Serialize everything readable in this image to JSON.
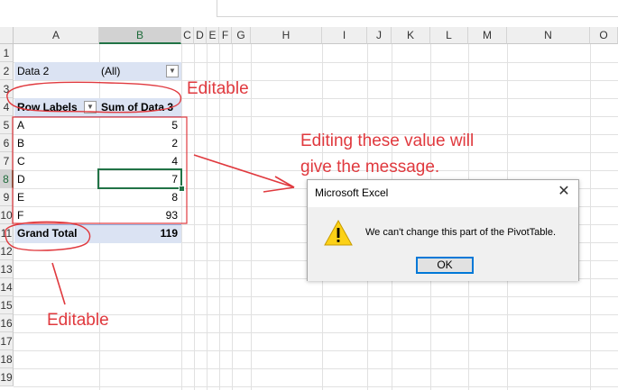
{
  "columns": [
    "A",
    "B",
    "C",
    "D",
    "E",
    "F",
    "G",
    "H",
    "I",
    "J",
    "K",
    "L",
    "M",
    "N",
    "O"
  ],
  "rows": [
    "1",
    "2",
    "3",
    "4",
    "5",
    "6",
    "7",
    "8",
    "9",
    "10",
    "11",
    "12",
    "13",
    "14",
    "15",
    "16",
    "17",
    "18",
    "19"
  ],
  "pivot": {
    "filter_label": "Data 2",
    "filter_value": "(All)",
    "row_labels_header": "Row Labels",
    "sum_header": "Sum of Data 3",
    "items": [
      {
        "label": "A",
        "value": "5"
      },
      {
        "label": "B",
        "value": "2"
      },
      {
        "label": "C",
        "value": "4"
      },
      {
        "label": "D",
        "value": "7"
      },
      {
        "label": "E",
        "value": "8"
      },
      {
        "label": "F",
        "value": "93"
      }
    ],
    "grand_total_label": "Grand Total",
    "grand_total_value": "119"
  },
  "annotations": {
    "editable_top": "Editable",
    "editing_msg_line1": "Editing these value will",
    "editing_msg_line2": "give the message.",
    "editable_bottom": "Editable",
    "color": "#e0393e"
  },
  "dialog": {
    "title": "Microsoft Excel",
    "message": "We can't change this part of the PivotTable.",
    "ok_label": "OK",
    "close_glyph": "✕",
    "icon": "warning-icon"
  },
  "colors": {
    "excel_green": "#217346",
    "pivot_header_bg": "#dbe3f3"
  }
}
